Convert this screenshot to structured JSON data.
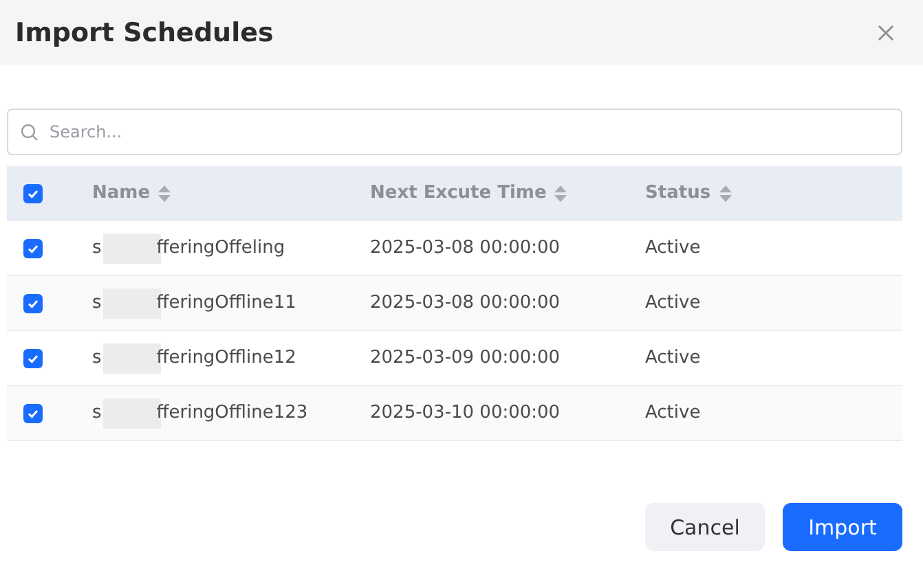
{
  "dialog": {
    "title": "Import Schedules"
  },
  "search": {
    "placeholder": "Search..."
  },
  "table": {
    "all_checked": true,
    "columns": [
      "Name",
      "Next Excute Time",
      "Status"
    ],
    "rows": [
      {
        "checked": true,
        "name_start": "s",
        "name_end": "fferingOffeling",
        "next_time": "2025-03-08 00:00:00",
        "status": "Active"
      },
      {
        "checked": true,
        "name_start": "s",
        "name_end": "fferingOffline11",
        "next_time": "2025-03-08 00:00:00",
        "status": "Active"
      },
      {
        "checked": true,
        "name_start": "s",
        "name_end": "fferingOffline12",
        "next_time": "2025-03-09 00:00:00",
        "status": "Active"
      },
      {
        "checked": true,
        "name_start": "s",
        "name_end": "fferingOffline123",
        "next_time": "2025-03-10 00:00:00",
        "status": "Active"
      }
    ]
  },
  "buttons": [
    {
      "label": "Cancel",
      "kind": "secondary"
    },
    {
      "label": "Import",
      "kind": "primary"
    }
  ]
}
